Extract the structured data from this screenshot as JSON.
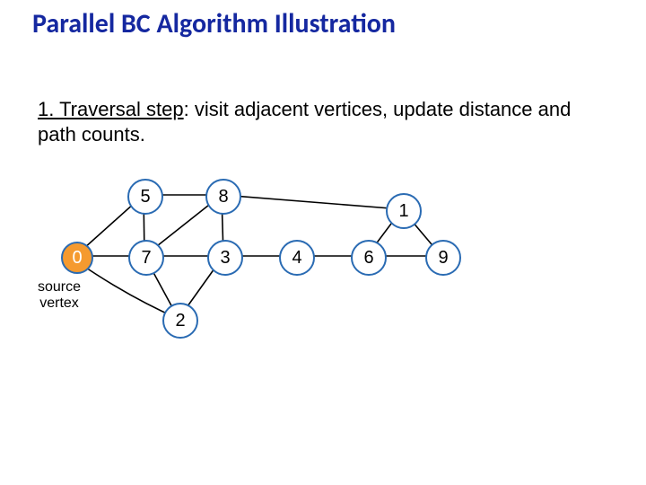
{
  "title": "Parallel BC Algorithm Illustration",
  "step": {
    "label": "1. Traversal step",
    "desc": ": visit adjacent vertices, update distance and path counts."
  },
  "source_label_line1": "source",
  "source_label_line2": "vertex",
  "nodes": {
    "n0": "0",
    "n5": "5",
    "n7": "7",
    "n2": "2",
    "n8": "8",
    "n3": "3",
    "n4": "4",
    "n6": "6",
    "n1": "1",
    "n9": "9"
  }
}
